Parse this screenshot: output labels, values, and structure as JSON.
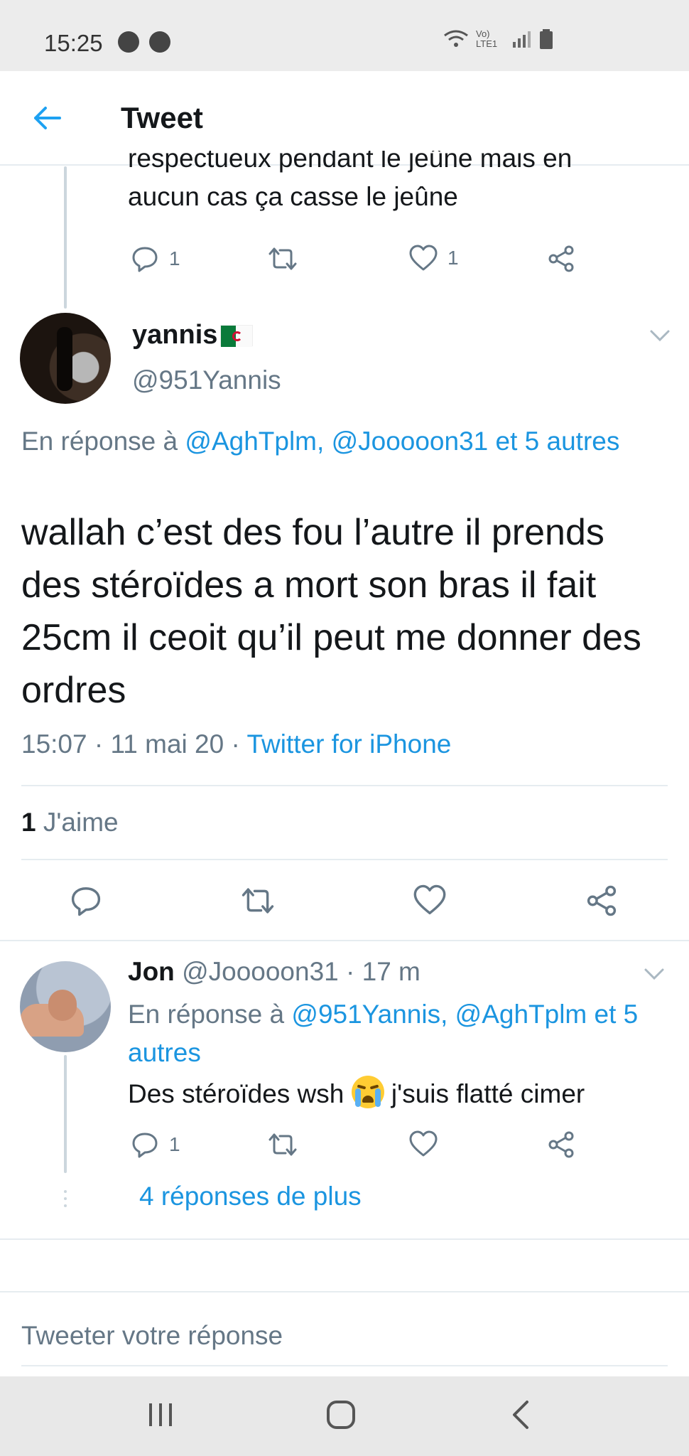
{
  "status_bar": {
    "time": "15:25",
    "network": "Vo) LTE1"
  },
  "app_bar": {
    "title": "Tweet"
  },
  "previous_tweet": {
    "text_line1": "respectueux pendant le jeûne mais en",
    "text_line2": "aucun cas ça casse le jeûne",
    "reply_count": "1",
    "like_count": "1"
  },
  "main_tweet": {
    "name": "yannis",
    "handle": "@951Yannis",
    "reply_prefix": "En réponse à",
    "reply_targets": "@AghTplm, @Jooooon31 et 5 autres",
    "text": "wallah c’est des fou l’autre il prends des stéroïdes a mort son bras il fait 25cm il ceoit qu’il peut me donner des ordres",
    "time": "15:07 · 11 mai 20 · ",
    "source": "Twitter for iPhone",
    "likes_count": "1",
    "likes_label": "J'aime"
  },
  "reply_tweet": {
    "name": "Jon",
    "handle_time": "@Jooooon31 · 17 m",
    "reply_prefix": "En réponse à",
    "reply_targets": "@951Yannis, @AghTplm et 5 autres",
    "text_before_emoji": "Des stéroïdes wsh ",
    "text_after_emoji": " j'suis flatté cimer",
    "reply_count": "1"
  },
  "more_replies": "4 réponses de plus",
  "compose": {
    "placeholder": "Tweeter votre réponse"
  },
  "colors": {
    "accent": "#1b95e0",
    "muted": "#657786",
    "text": "#14171a",
    "divider": "#e6ecf0"
  },
  "icons": [
    "messenger-icon",
    "spotify-icon",
    "wifi-icon",
    "signal-icon",
    "battery-icon",
    "back-arrow-icon",
    "reply-icon",
    "retweet-icon",
    "like-icon",
    "share-icon",
    "chevron-down-icon",
    "recent-apps-icon",
    "home-icon",
    "back-nav-icon"
  ]
}
